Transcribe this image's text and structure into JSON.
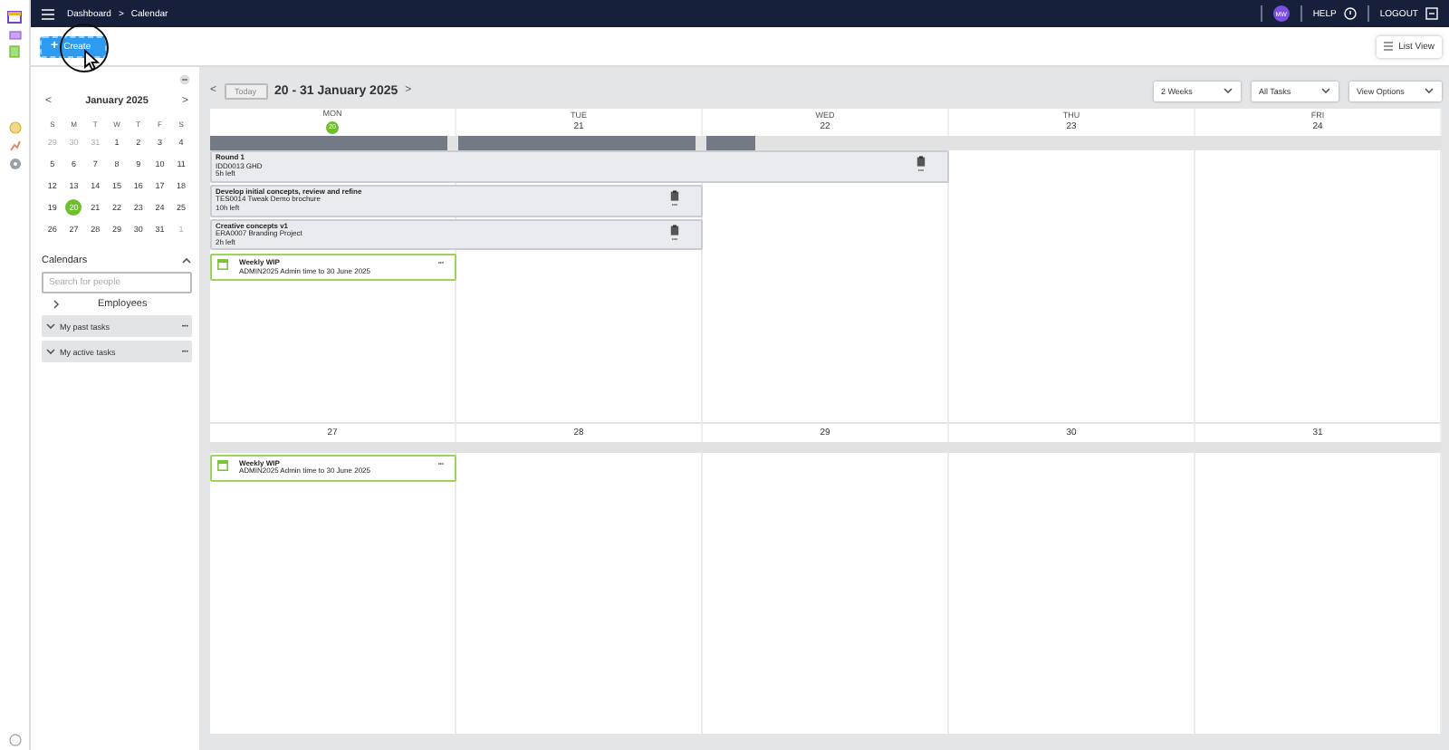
{
  "topbar": {
    "breadcrumbs": [
      "Dashboard",
      "Calendar"
    ],
    "separator": ">",
    "avatar": "MW",
    "help": "HELP",
    "logout": "LOGOUT"
  },
  "toolbar": {
    "create": "Create",
    "create_icon": "+",
    "list_view": "List View"
  },
  "mini_calendar": {
    "month": "January 2025",
    "prev": "<",
    "next": ">",
    "weekdays": [
      "S",
      "M",
      "T",
      "W",
      "T",
      "F",
      "S"
    ],
    "days": [
      {
        "label": "29",
        "muted": true,
        "selected": false
      },
      {
        "label": "30",
        "muted": true,
        "selected": false
      },
      {
        "label": "31",
        "muted": true,
        "selected": false
      },
      {
        "label": "1",
        "muted": false,
        "selected": false
      },
      {
        "label": "2",
        "muted": false,
        "selected": false
      },
      {
        "label": "3",
        "muted": false,
        "selected": false
      },
      {
        "label": "4",
        "muted": false,
        "selected": false
      },
      {
        "label": "5",
        "muted": false,
        "selected": false
      },
      {
        "label": "6",
        "muted": false,
        "selected": false
      },
      {
        "label": "7",
        "muted": false,
        "selected": false
      },
      {
        "label": "8",
        "muted": false,
        "selected": false
      },
      {
        "label": "9",
        "muted": false,
        "selected": false
      },
      {
        "label": "10",
        "muted": false,
        "selected": false
      },
      {
        "label": "11",
        "muted": false,
        "selected": false
      },
      {
        "label": "12",
        "muted": false,
        "selected": false
      },
      {
        "label": "13",
        "muted": false,
        "selected": false
      },
      {
        "label": "14",
        "muted": false,
        "selected": false
      },
      {
        "label": "15",
        "muted": false,
        "selected": false
      },
      {
        "label": "16",
        "muted": false,
        "selected": false
      },
      {
        "label": "17",
        "muted": false,
        "selected": false
      },
      {
        "label": "18",
        "muted": false,
        "selected": false
      },
      {
        "label": "19",
        "muted": false,
        "selected": false
      },
      {
        "label": "20",
        "muted": false,
        "selected": true
      },
      {
        "label": "21",
        "muted": false,
        "selected": false
      },
      {
        "label": "22",
        "muted": false,
        "selected": false
      },
      {
        "label": "23",
        "muted": false,
        "selected": false
      },
      {
        "label": "24",
        "muted": false,
        "selected": false
      },
      {
        "label": "25",
        "muted": false,
        "selected": false
      },
      {
        "label": "26",
        "muted": false,
        "selected": false
      },
      {
        "label": "27",
        "muted": false,
        "selected": false
      },
      {
        "label": "28",
        "muted": false,
        "selected": false
      },
      {
        "label": "29",
        "muted": false,
        "selected": false
      },
      {
        "label": "30",
        "muted": false,
        "selected": false
      },
      {
        "label": "31",
        "muted": false,
        "selected": false
      },
      {
        "label": "1",
        "muted": true,
        "selected": false
      }
    ]
  },
  "calendars": {
    "title": "Calendars",
    "expanded": true,
    "search": {
      "placeholder": "Search for people"
    },
    "employees": {
      "label": "Employees",
      "expanded": false
    },
    "task_lists": [
      {
        "label": "My past tasks",
        "expanded": true,
        "menu": "•••"
      },
      {
        "label": "My active tasks",
        "expanded": true,
        "menu": "•••"
      }
    ]
  },
  "calendar": {
    "prev": "<",
    "next": ">",
    "today": "Today",
    "range": "20 - 31 January 2025",
    "filters": [
      {
        "label": "2 Weeks"
      },
      {
        "label": "All Tasks"
      },
      {
        "label": "View Options"
      }
    ],
    "weeks": [
      {
        "days": [
          {
            "weekday": "MON",
            "date": "20",
            "today": true,
            "level": 1
          },
          {
            "weekday": "TUE",
            "date": "21",
            "today": false,
            "level": 1
          },
          {
            "weekday": "WED",
            "date": "22",
            "today": false,
            "level": 0.2
          },
          {
            "weekday": "THU",
            "date": "23",
            "today": false
          },
          {
            "weekday": "FRI",
            "date": "24",
            "today": false
          }
        ],
        "events": [
          {
            "kind": "task",
            "level": 0.6,
            "title": "Round 1",
            "code": "IDD0013 GHD",
            "left": "5h left",
            "menu": "•••"
          },
          {
            "kind": "task",
            "level": 0.4,
            "title": "Develop initial concepts, review and refine",
            "code": "TES0014 Tweak Demo brochure",
            "left": "10h left",
            "menu": "•••"
          },
          {
            "kind": "task",
            "level": 0.4,
            "title": "Creative concepts v1",
            "code": "ERA0007 Branding Project",
            "left": "2h left",
            "menu": "•••"
          },
          {
            "kind": "recurring",
            "level": 0.2,
            "title": "Weekly WIP",
            "code": "ADMIN2025 Admin time to 30 June 2025",
            "menu": "•••"
          }
        ]
      },
      {
        "days": [
          {
            "date": "27",
            "today": false
          },
          {
            "date": "28",
            "today": false
          },
          {
            "date": "29",
            "today": false
          },
          {
            "date": "30",
            "today": false
          },
          {
            "date": "31",
            "today": false
          }
        ],
        "events": [
          {
            "kind": "recurring",
            "level": 0.2,
            "title": "Weekly WIP",
            "code": "ADMIN2025 Admin time to 30 June 2025",
            "menu": "•••"
          }
        ]
      }
    ]
  }
}
